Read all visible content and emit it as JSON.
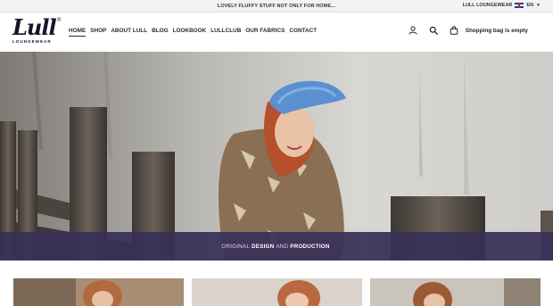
{
  "topbar": {
    "promo": "LOVELY FLUFFY STUFF NOT ONLY FOR HOME...",
    "brand_link": "LULL LOUNGEWEAR",
    "language": "EN",
    "language_caret": "▼"
  },
  "logo": {
    "script": "Lull",
    "subtitle": "LOUNGEWEAR",
    "registered": "®"
  },
  "nav": {
    "items": [
      {
        "label": "HOME",
        "active": true
      },
      {
        "label": "SHOP"
      },
      {
        "label": "ABOUT LULL"
      },
      {
        "label": "BLOG"
      },
      {
        "label": "LOOKBOOK"
      },
      {
        "label": "LULLCLUB"
      },
      {
        "label": "OUR FABRICS"
      },
      {
        "label": "CONTACT"
      }
    ]
  },
  "header_actions": {
    "account_icon": "user-icon",
    "search_icon": "search-icon",
    "cart_icon": "shopping-bag-icon",
    "cart_label": "Shopping bag is empty"
  },
  "hero": {
    "caption_before": "ORIGINAL",
    "caption_design": "DESIGN",
    "caption_and": "AND",
    "caption_production": "PRODUCTION"
  },
  "colors": {
    "accent": "#383058",
    "text": "#1f1f2e",
    "hat": "#5b8fd0",
    "hair": "#b4502c"
  }
}
